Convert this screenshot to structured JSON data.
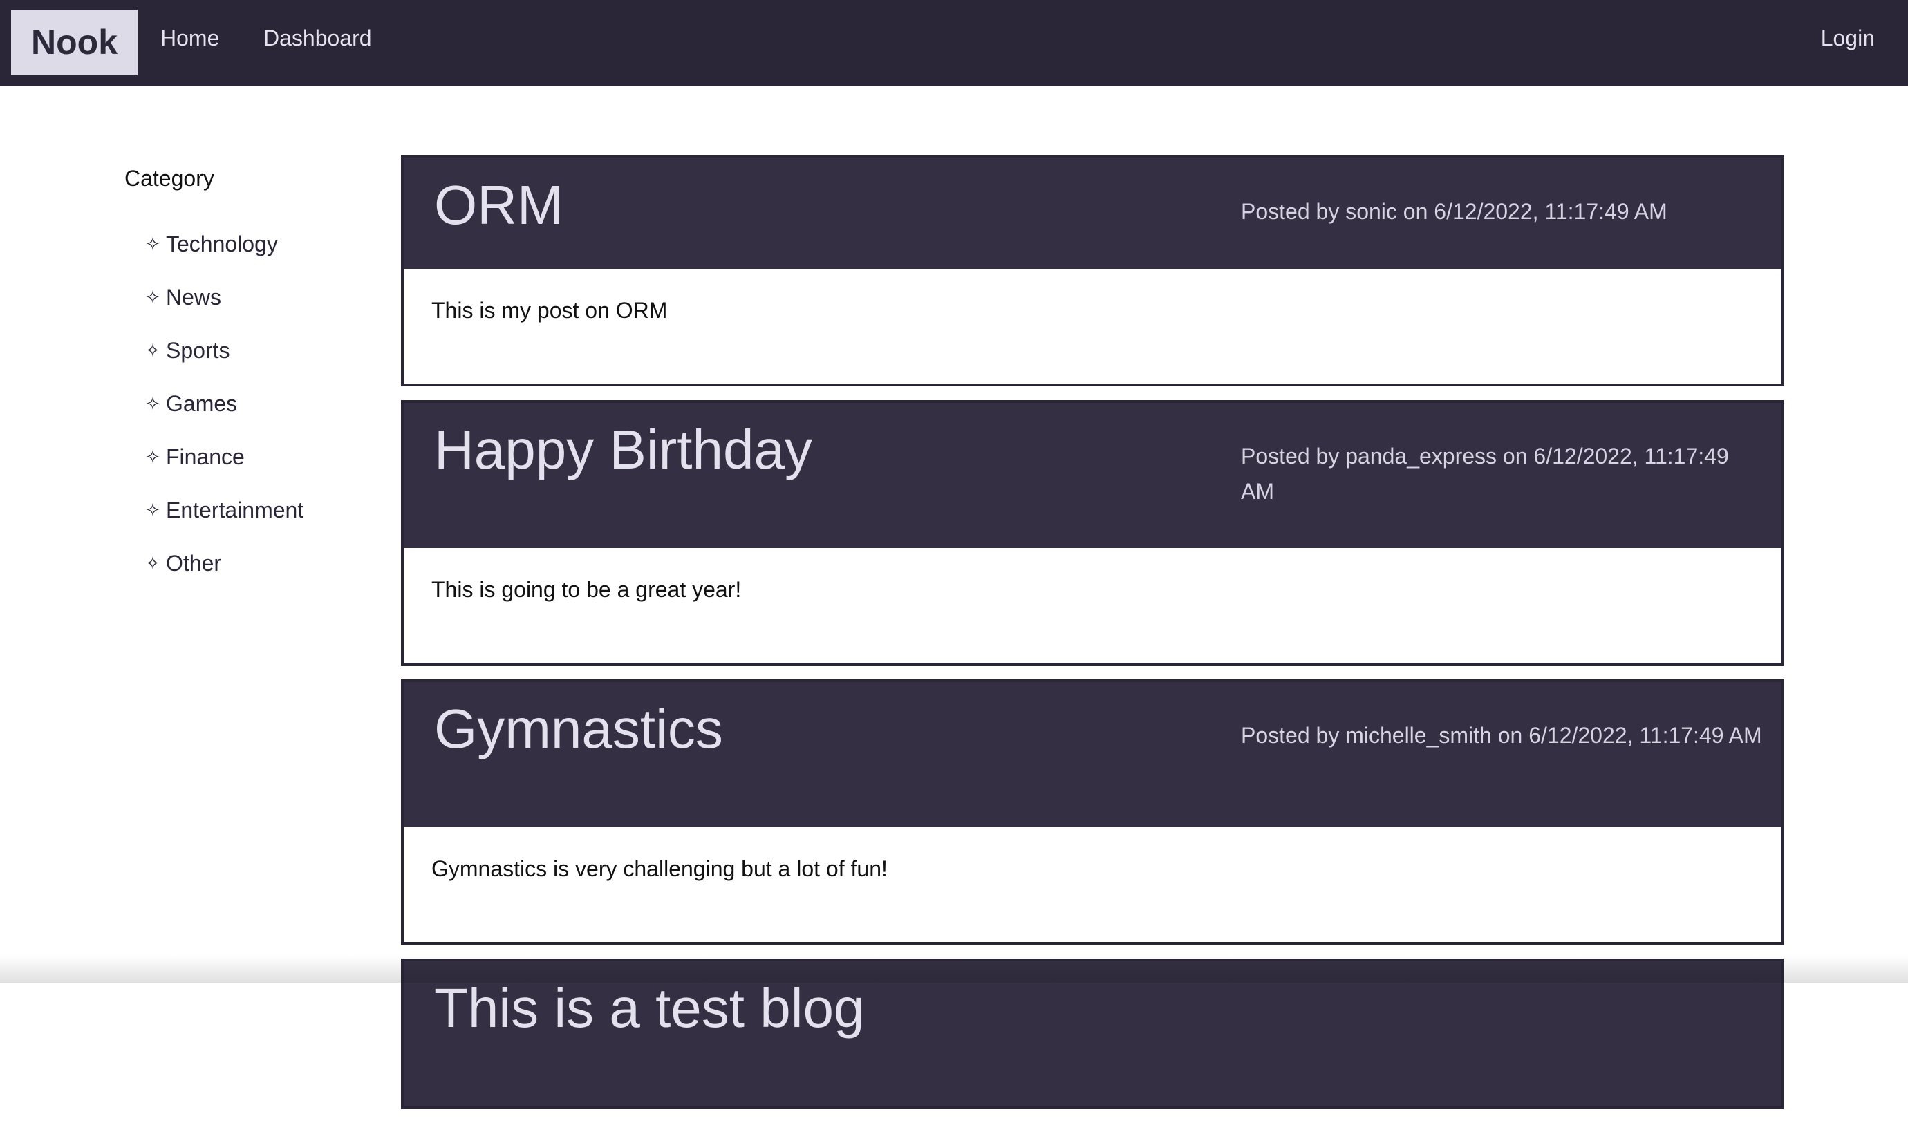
{
  "navbar": {
    "brand": "Nook",
    "links": [
      "Home",
      "Dashboard"
    ],
    "login": "Login"
  },
  "sidebar": {
    "title": "Category",
    "icon": "diamond-star-icon",
    "items": [
      "Technology",
      "News",
      "Sports",
      "Games",
      "Finance",
      "Entertainment",
      "Other"
    ]
  },
  "posts": [
    {
      "title": "ORM",
      "meta": "Posted by sonic on 6/12/2022, 11:17:49 AM",
      "body": "This is my post on ORM"
    },
    {
      "title": "Happy Birthday",
      "meta": "Posted by panda_express on 6/12/2022, 11:17:49 AM",
      "body": "This is going to be a great year!"
    },
    {
      "title": "Gymnastics",
      "meta": "Posted by michelle_smith on 6/12/2022, 11:17:49 AM",
      "body": "Gymnastics is very challenging but a lot of fun!"
    },
    {
      "title": "This is a test blog",
      "meta": "",
      "body": ""
    }
  ],
  "colors": {
    "navbar_bg": "#2a2638",
    "post_header_bg": "#342f42",
    "brand_bg": "#dddbe8"
  }
}
